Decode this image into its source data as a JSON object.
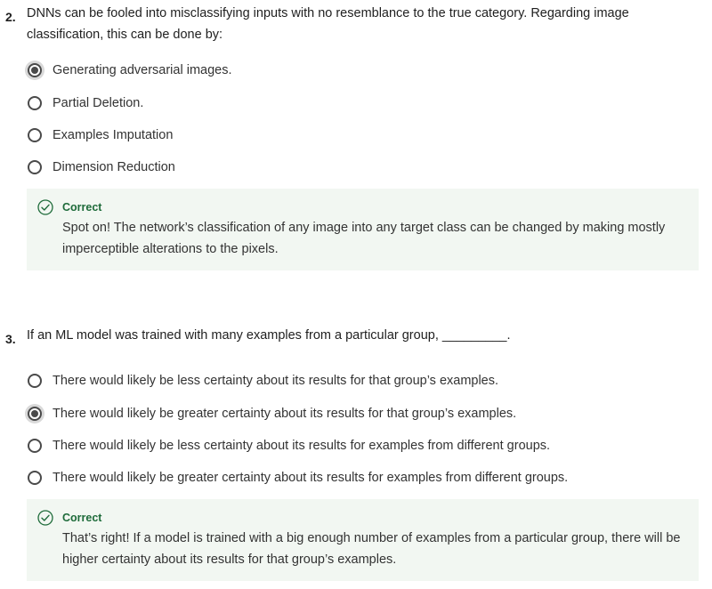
{
  "questions": [
    {
      "number": "2.",
      "text": "DNNs can be fooled into misclassifying inputs with no resemblance to the true category. Regarding image classification, this can be done by:",
      "options": [
        {
          "label": "Generating adversarial images.",
          "selected": true
        },
        {
          "label": "Partial Deletion.",
          "selected": false
        },
        {
          "label": "Examples Imputation",
          "selected": false
        },
        {
          "label": "Dimension Reduction",
          "selected": false
        }
      ],
      "feedback": {
        "status": "Correct",
        "icon": "check-circle-icon",
        "text": "Spot on! The network’s classification of any image into any target class can be changed by making mostly imperceptible alterations to the pixels."
      }
    },
    {
      "number": "3.",
      "text": "If an ML model was trained with many examples from a particular group, _________.",
      "options": [
        {
          "label": "There would likely be less certainty about its results for that group’s examples.",
          "selected": false
        },
        {
          "label": "There would likely be greater certainty about its results for that group’s examples.",
          "selected": true
        },
        {
          "label": "There would likely be less certainty about its results for examples from different groups.",
          "selected": false
        },
        {
          "label": "There would likely be greater certainty about its results for examples from different groups.",
          "selected": false
        }
      ],
      "feedback": {
        "status": "Correct",
        "icon": "check-circle-icon",
        "text": "That’s right! If a model is trained with a big enough number of examples from a particular group, there will be higher certainty about its results for that group’s examples."
      }
    }
  ],
  "colors": {
    "feedback_background": "#f2f7f2",
    "correct_green": "#1e6b3a",
    "radio_border": "#4a4a4a",
    "selected_halo": "#d9d9d9"
  }
}
